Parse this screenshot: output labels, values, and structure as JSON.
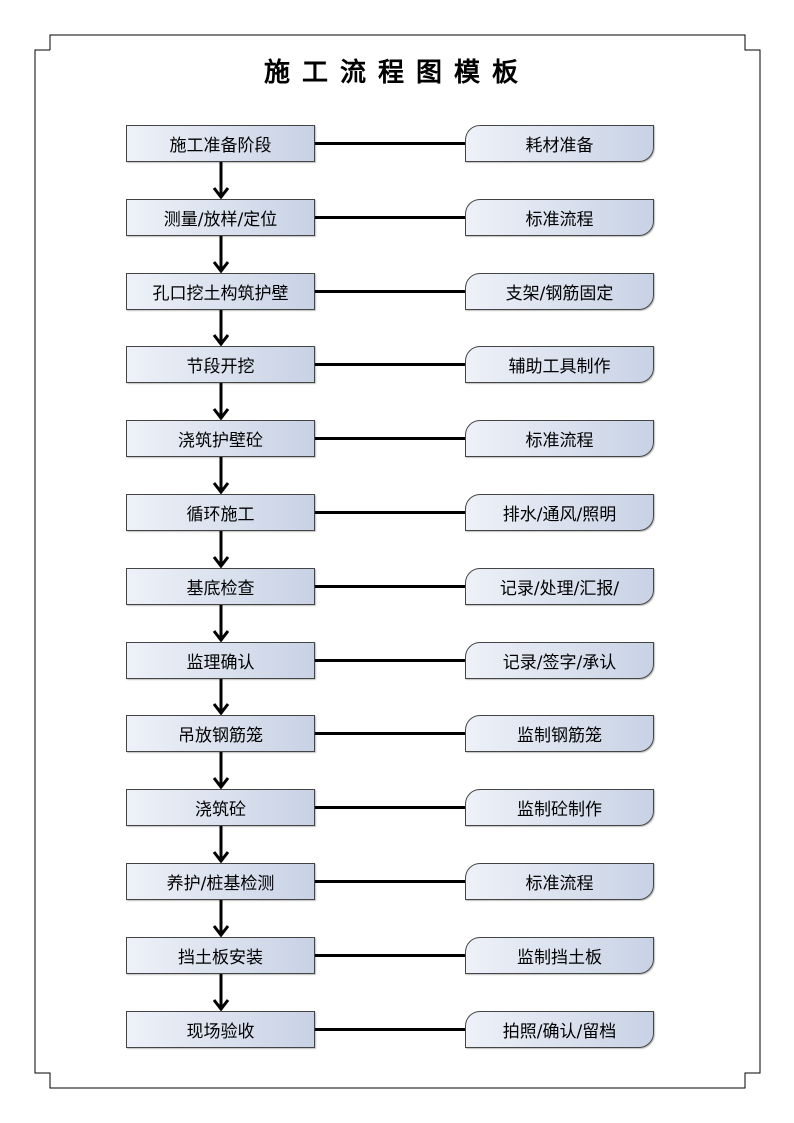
{
  "title": "施工流程图模板",
  "colors": {
    "box_start": "#eef1f8",
    "box_end": "#c8d2e5",
    "line": "#000000"
  },
  "steps": [
    {
      "main": "施工准备阶段",
      "side": "耗材准备"
    },
    {
      "main": "测量/放样/定位",
      "side": "标准流程"
    },
    {
      "main": "孔口挖土构筑护壁",
      "side": "支架/钢筋固定"
    },
    {
      "main": "节段开挖",
      "side": "辅助工具制作"
    },
    {
      "main": "浇筑护壁砼",
      "side": "标准流程"
    },
    {
      "main": "循环施工",
      "side": "排水/通风/照明"
    },
    {
      "main": "基底检查",
      "side": "记录/处理/汇报/"
    },
    {
      "main": "监理确认",
      "side": "记录/签字/承认"
    },
    {
      "main": "吊放钢筋笼",
      "side": "监制钢筋笼"
    },
    {
      "main": "浇筑砼",
      "side": "监制砼制作"
    },
    {
      "main": "养护/桩基检测",
      "side": "标准流程"
    },
    {
      "main": "挡土板安装",
      "side": "监制挡土板"
    },
    {
      "main": "现场验收",
      "side": "拍照/确认/留档"
    }
  ]
}
